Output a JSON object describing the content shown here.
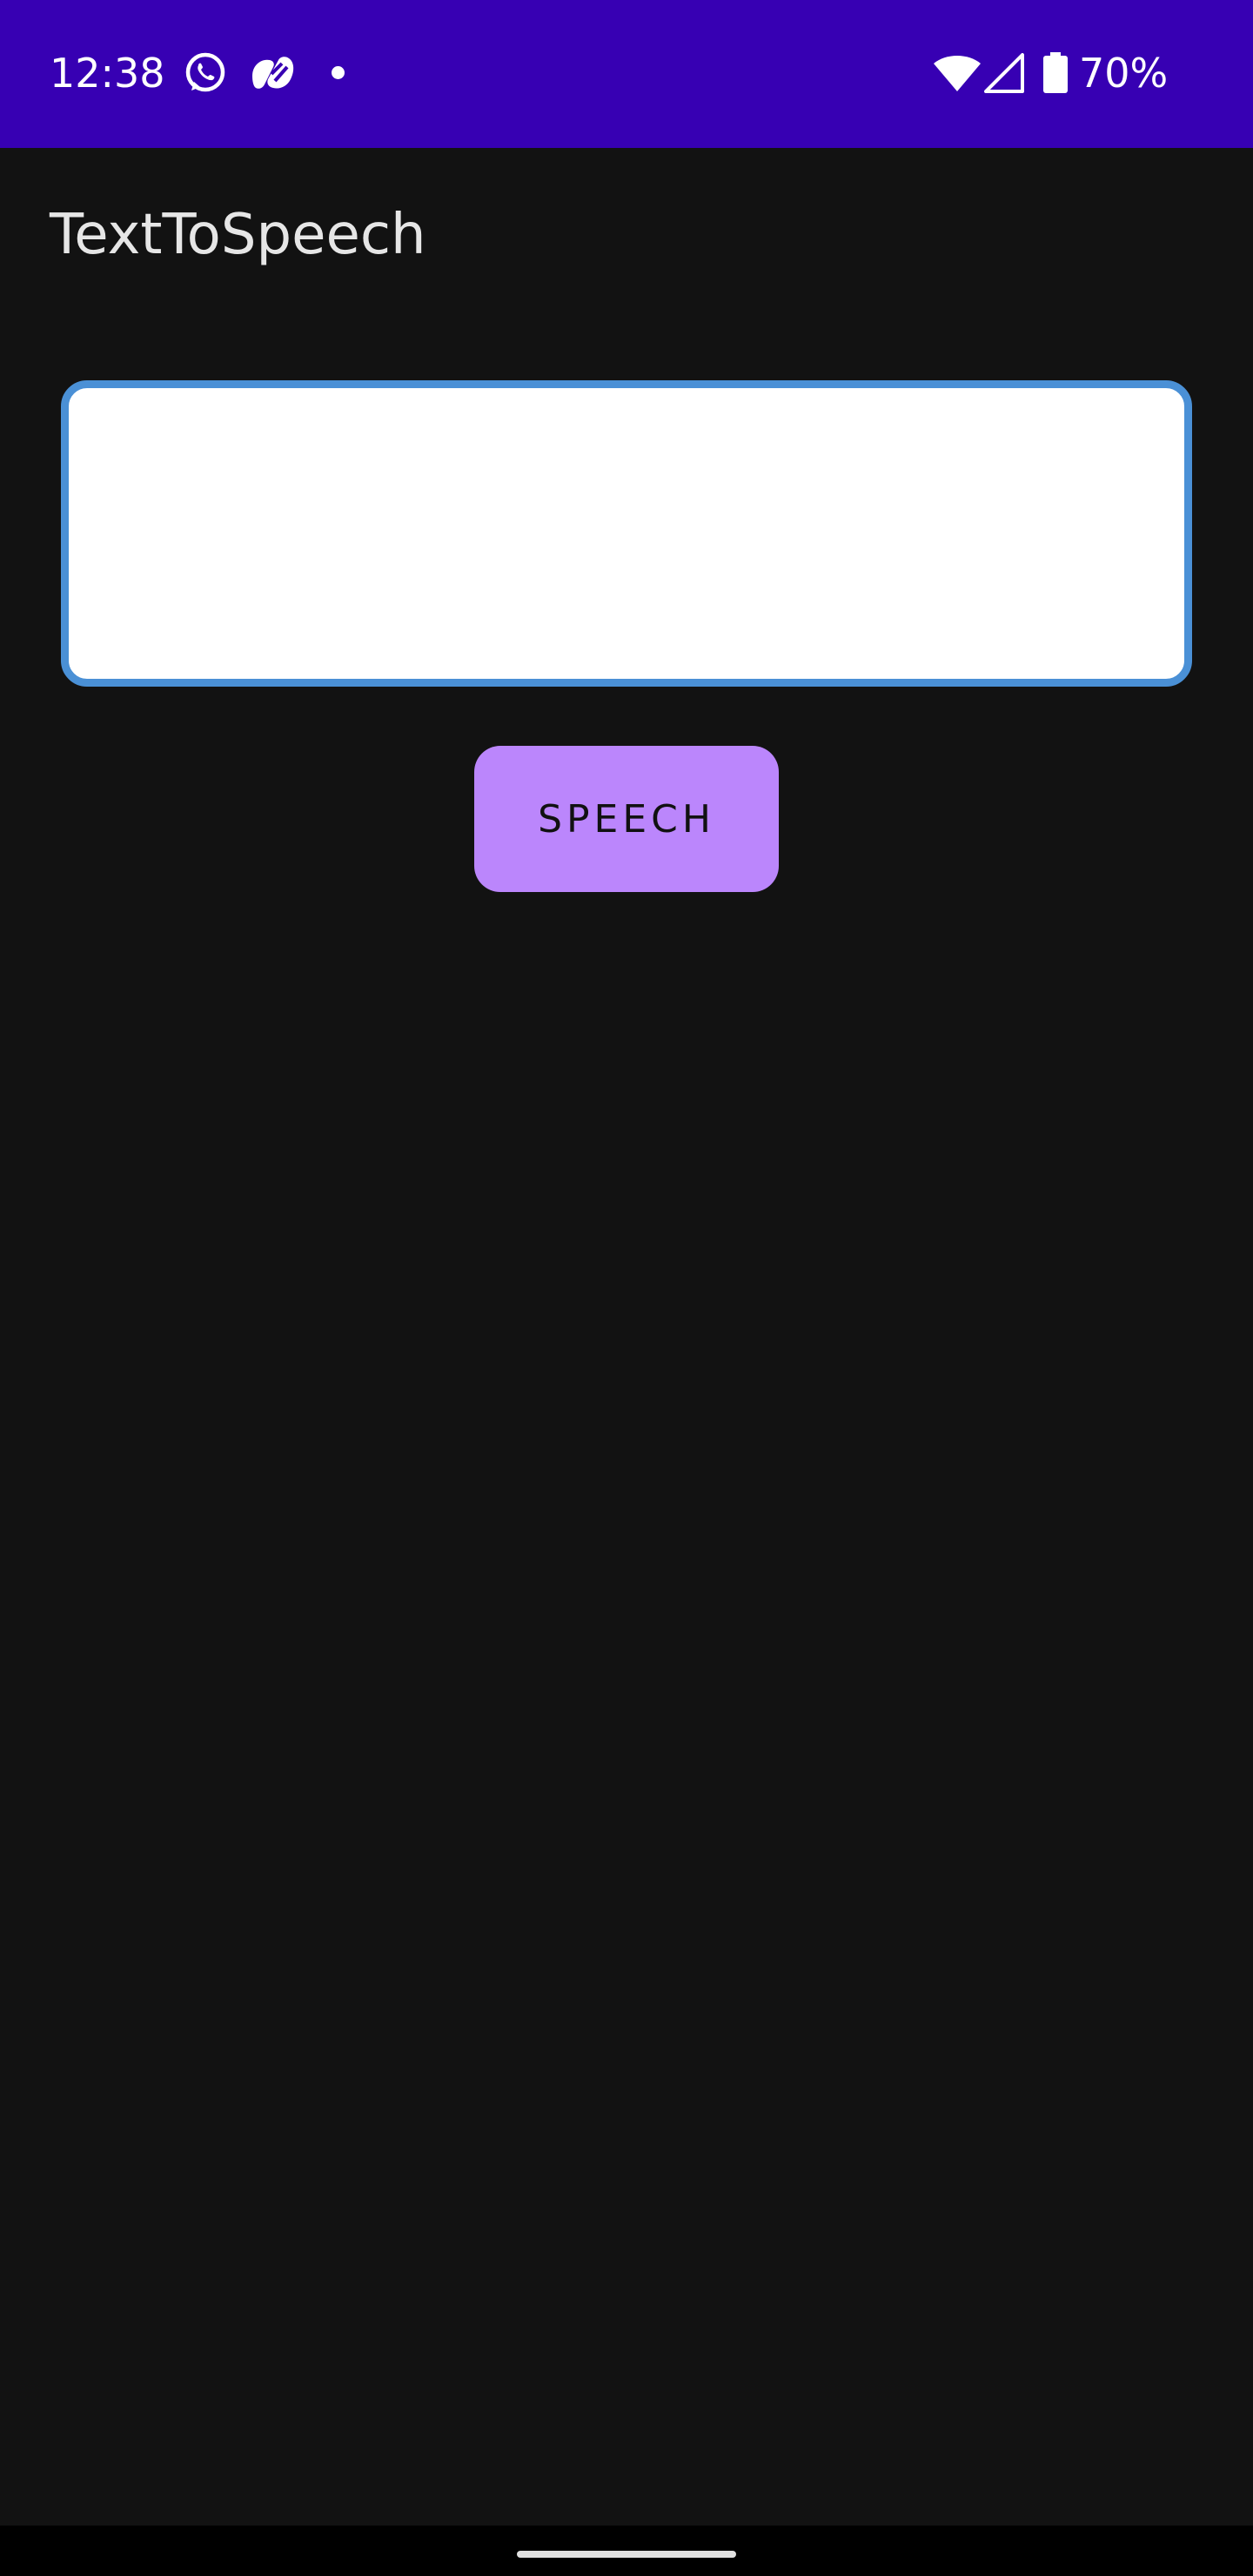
{
  "status_bar": {
    "time": "12:38",
    "battery_percent": "70%",
    "background_color": "#3700b3",
    "icons": [
      "whatsapp-icon",
      "app-notification-icon",
      "notification-dot-icon",
      "wifi-icon",
      "cellular-signal-icon",
      "battery-icon"
    ],
    "battery_level": 0.7
  },
  "app_bar": {
    "title": "TextToSpeech"
  },
  "main": {
    "text_input": {
      "value": "",
      "placeholder": "",
      "border_color": "#4a90d6"
    },
    "speech_button": {
      "label": "SPEECH",
      "color": "#bb86fc"
    }
  },
  "theme": {
    "background_color": "#121212",
    "title_color": "#e6e6e6"
  }
}
